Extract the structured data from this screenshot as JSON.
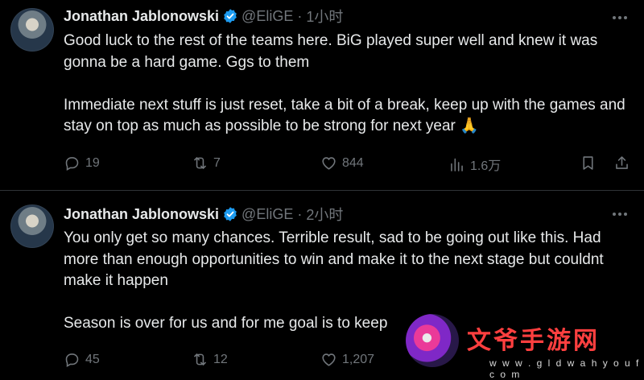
{
  "tweets": [
    {
      "author": {
        "name": "Jonathan Jablonowski",
        "handle": "@EliGE",
        "time": "1小时"
      },
      "text": "Good luck to the rest of the teams here. BiG played super well and knew it was gonna be a hard game. Ggs to them\n\nImmediate next stuff is just reset, take a bit of a break, keep up with the games and stay on top as much as possible to be strong for next year 🙏",
      "actions": {
        "replies": "19",
        "reposts": "7",
        "likes": "844",
        "views": "1.6万"
      }
    },
    {
      "author": {
        "name": "Jonathan Jablonowski",
        "handle": "@EliGE",
        "time": "2小时"
      },
      "text": "You only get so many chances. Terrible result, sad to be going out like this. Had more than enough opportunities to win and make it to the next stage but couldnt make it happen\n\nSeason is over for us and for me goal is to keep",
      "actions": {
        "replies": "45",
        "reposts": "12",
        "likes": "1,207"
      }
    }
  ],
  "separator": "·",
  "watermark": {
    "title": "文爷手游网",
    "url": "w w w . g l d w a h y o u f c o m"
  },
  "colors": {
    "background": "#000000",
    "text": "#e7e9ea",
    "muted": "#71767b",
    "verified": "#1d9bf0",
    "divider": "#2f3336"
  }
}
